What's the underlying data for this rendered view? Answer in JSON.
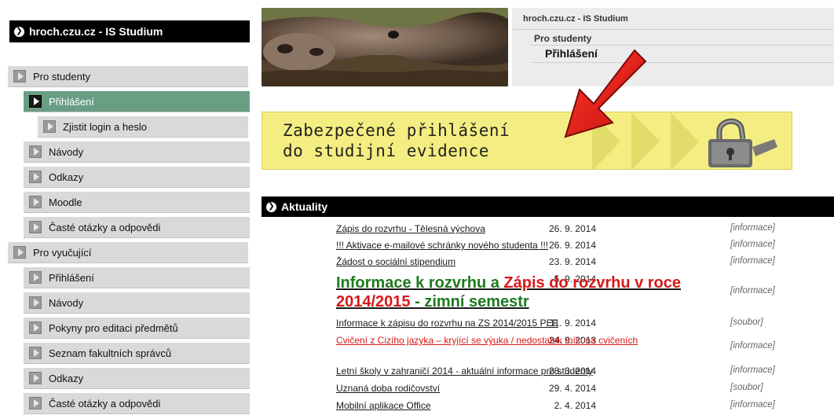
{
  "site": {
    "name": "hroch.czu.cz - IS Studium"
  },
  "breadcrumb": {
    "site": "hroch.czu.cz - IS Studium",
    "section": "Pro studenty",
    "current": "Přihlášení"
  },
  "sidebar": {
    "items": [
      {
        "label": "Pro studenty",
        "level": 0,
        "active": false
      },
      {
        "label": "Přihlášení",
        "level": 1,
        "active": true
      },
      {
        "label": "Zjistit login a heslo",
        "level": 2,
        "active": false
      },
      {
        "label": "Návody",
        "level": 1,
        "active": false
      },
      {
        "label": "Odkazy",
        "level": 1,
        "active": false
      },
      {
        "label": "Moodle",
        "level": 1,
        "active": false
      },
      {
        "label": "Časté otázky a odpovědi",
        "level": 1,
        "active": false
      },
      {
        "label": "Pro vyučující",
        "level": 0,
        "active": false
      },
      {
        "label": "Přihlášení",
        "level": 1,
        "active": false
      },
      {
        "label": "Návody",
        "level": 1,
        "active": false
      },
      {
        "label": "Pokyny pro editaci předmětů",
        "level": 1,
        "active": false
      },
      {
        "label": "Seznam fakultních správců",
        "level": 1,
        "active": false
      },
      {
        "label": "Odkazy",
        "level": 1,
        "active": false
      },
      {
        "label": "Časté otázky a odpovědi",
        "level": 1,
        "active": false
      }
    ]
  },
  "banner": {
    "line1": "Zabezpečené přihlášení",
    "line2": "do studijní evidence"
  },
  "news": {
    "title": "Aktuality",
    "items": [
      {
        "date": "26. 9. 2014",
        "title": "Zápis do rozvrhu - Tělesná výchova",
        "type": "[informace]"
      },
      {
        "date": "26. 9. 2014",
        "title": "!!! Aktivace e-mailové schránky nového studenta !!!",
        "type": "[informace]"
      },
      {
        "date": "23. 9. 2014",
        "title": "Žádost o sociální stipendium",
        "type": "[informace]"
      },
      {
        "date": "5. 9. 2014",
        "title_parts": [
          "Informace k rozvrhu a ",
          "Zápis do rozvrhu v roce 2014/2015",
          " - zimní semestr"
        ],
        "type": "[informace]"
      },
      {
        "date": "11. 9. 2014",
        "title": "Informace k zápisu do rozvrhu na ZS 2014/2015 PEF",
        "type": "[soubor]"
      },
      {
        "date": "24. 9. 2013",
        "title": "Cvičení z Cizího jazyka – kryjící se výuka / nedostatek míst na cvičeních",
        "type": "[informace]"
      },
      {
        "date": "28. 3. 2014",
        "title": "Letní školy v zahraničí 2014 - aktuální informace pro studenty",
        "type": "[informace]"
      },
      {
        "date": "29. 4. 2014",
        "title": "Uznaná doba rodičovství",
        "type": "[soubor]"
      },
      {
        "date": "2. 4. 2014",
        "title": "Mobilní aplikace Office",
        "type": "[informace]"
      }
    ]
  },
  "colors": {
    "active_nav": "#6a9e84",
    "nav_bg": "#d9d9d9",
    "banner_bg": "#f4ee82",
    "header_bg": "#000000",
    "green": "#1d7a1d",
    "red": "#d81818"
  }
}
